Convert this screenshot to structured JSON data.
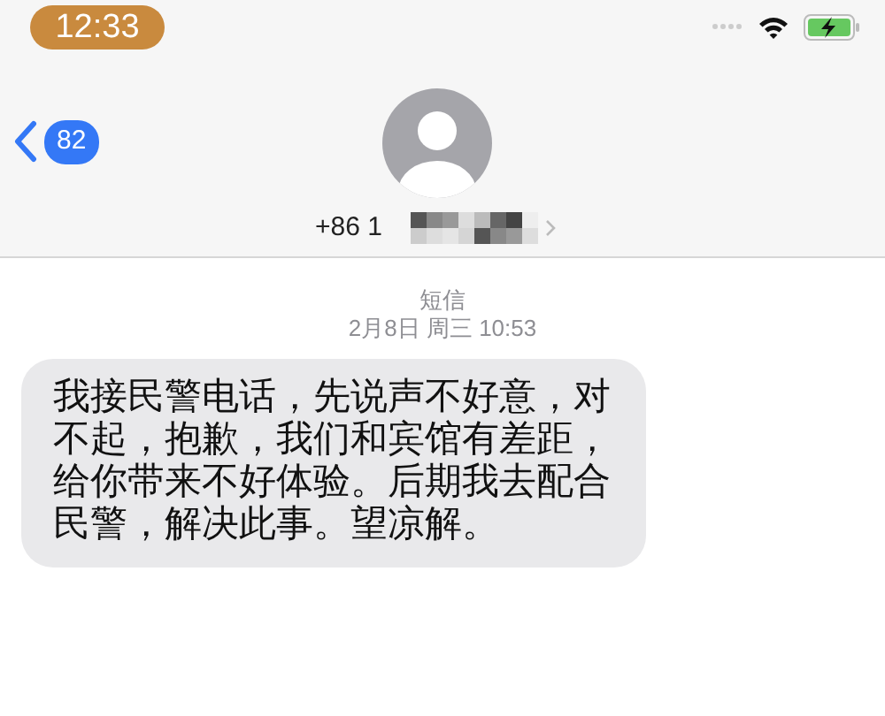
{
  "status_bar": {
    "time": "12:33"
  },
  "header": {
    "back_count": "82",
    "contact": "+86 1"
  },
  "conversation": {
    "service": "短信",
    "timestamp": "2月8日 周三 10:53",
    "messages": [
      {
        "kind": "received",
        "text": "我接民警电话，先说声不好意，对不起，抱歉，我们和宾馆有差距，给你带来不好体验。后期我去配合民警，解决此事。望凉解。"
      }
    ]
  }
}
